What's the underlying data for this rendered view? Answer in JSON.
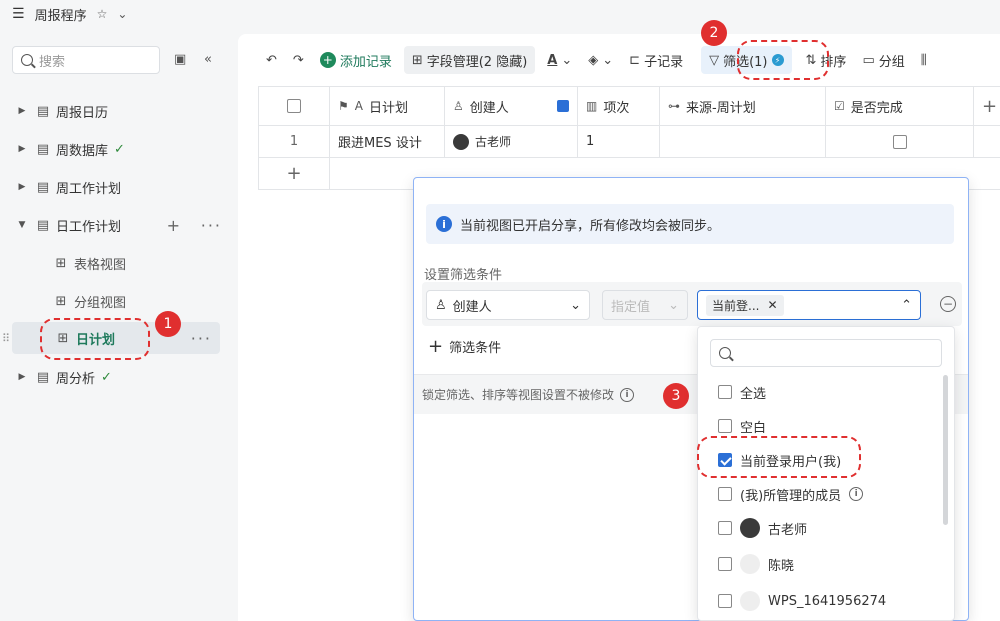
{
  "app": {
    "title": "周报程序"
  },
  "sidebar": {
    "search_placeholder": "搜索",
    "items": [
      {
        "label": "周报日历"
      },
      {
        "label": "周数据库"
      },
      {
        "label": "周工作计划"
      },
      {
        "label": "日工作计划"
      },
      {
        "label": "表格视图"
      },
      {
        "label": "分组视图"
      },
      {
        "label": "日计划"
      },
      {
        "label": "周分析"
      }
    ]
  },
  "toolbar": {
    "add_record": "添加记录",
    "field_manage": "字段管理(2 隐藏)",
    "sub_record": "子记录",
    "filter": "筛选(1)",
    "sort": "排序",
    "group": "分组"
  },
  "table": {
    "columns": [
      "日计划",
      "创建人",
      "项次",
      "来源-周计划",
      "是否完成"
    ],
    "rows": [
      {
        "index": "1",
        "plan": "跟进MES 设计",
        "creator": "古老师",
        "item": "1",
        "source": "",
        "done": false
      }
    ]
  },
  "filter_panel": {
    "notice": "当前视图已开启分享，所有修改均会被同步。",
    "section_title": "设置筛选条件",
    "field": "创建人",
    "operator": "指定值",
    "value_chip": "当前登...",
    "add_condition": "筛选条件",
    "lock_text": "锁定筛选、排序等视图设置不被修改"
  },
  "dropdown": {
    "options": [
      {
        "label": "全选",
        "checked": false
      },
      {
        "label": "空白",
        "checked": false
      },
      {
        "label": "当前登录用户(我)",
        "checked": true
      },
      {
        "label": "(我)所管理的成员",
        "checked": false
      },
      {
        "label": "古老师",
        "checked": false
      },
      {
        "label": "陈晓",
        "checked": false
      },
      {
        "label": "WPS_1641956274",
        "checked": false
      }
    ]
  },
  "annotations": {
    "step1": "1",
    "step2": "2",
    "step3": "3"
  },
  "colors": {
    "accent_green": "#1f8a5c",
    "annotation_red": "#e02f2f",
    "filter_blue": "#2b6fd6"
  }
}
